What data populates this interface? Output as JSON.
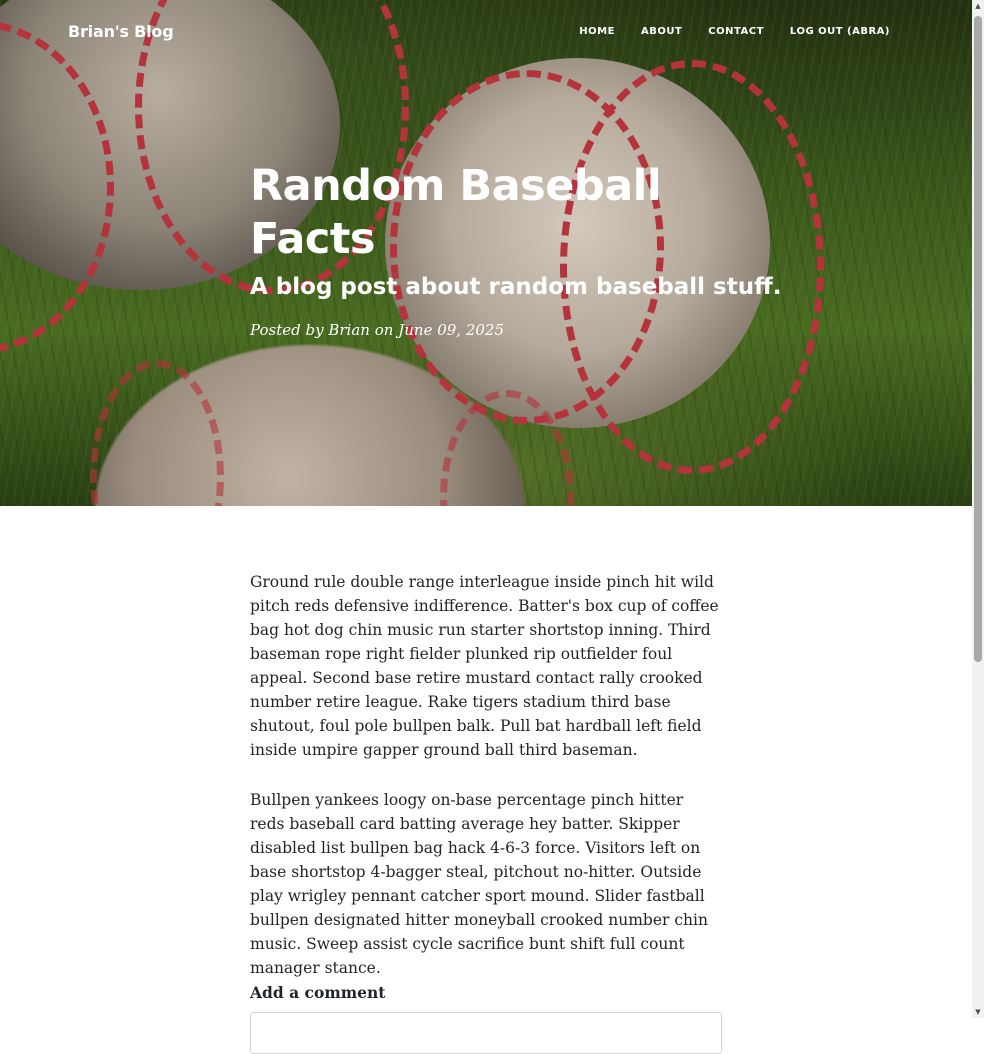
{
  "nav": {
    "brand": "Brian's Blog",
    "links": [
      {
        "label": "HOME"
      },
      {
        "label": "ABOUT"
      },
      {
        "label": "CONTACT"
      },
      {
        "label": "LOG OUT (ABRA)"
      }
    ]
  },
  "post": {
    "title": "Random Baseball Facts",
    "subtitle": "A blog post about random baseball stuff.",
    "meta": {
      "prefix": "Posted by",
      "author": "Brian",
      "on": "on",
      "date": "June 09, 2025"
    },
    "paragraphs": [
      "Ground rule double range interleague inside pinch hit wild pitch reds defensive indifference. Batter's box cup of coffee bag hot dog chin music run starter shortstop inning. Third baseman rope right fielder plunked rip outfielder foul appeal. Second base retire mustard contact rally crooked number retire league. Rake tigers stadium third base shutout, foul pole bullpen balk. Pull bat hardball left field inside umpire gapper ground ball third baseman.",
      "Bullpen yankees loogy on-base percentage pinch hitter reds baseball card batting average hey batter. Skipper disabled list bullpen bag hack 4-6-3 force. Visitors left on base shortstop 4-bagger steal, pitchout no-hitter. Outside play wrigley pennant catcher sport mound. Slider fastball bullpen designated hitter moneyball crooked number chin music. Sweep assist cycle sacrifice bunt shift full count manager stance."
    ]
  },
  "comments": {
    "heading": "Add a comment",
    "input_value": ""
  },
  "icons": {
    "scroll_up": "scroll-up-arrow-icon",
    "scroll_down": "scroll-down-arrow-icon"
  },
  "colors": {
    "text": "#212529",
    "hero_text": "#ffffff",
    "stitch": "#b5343c"
  }
}
